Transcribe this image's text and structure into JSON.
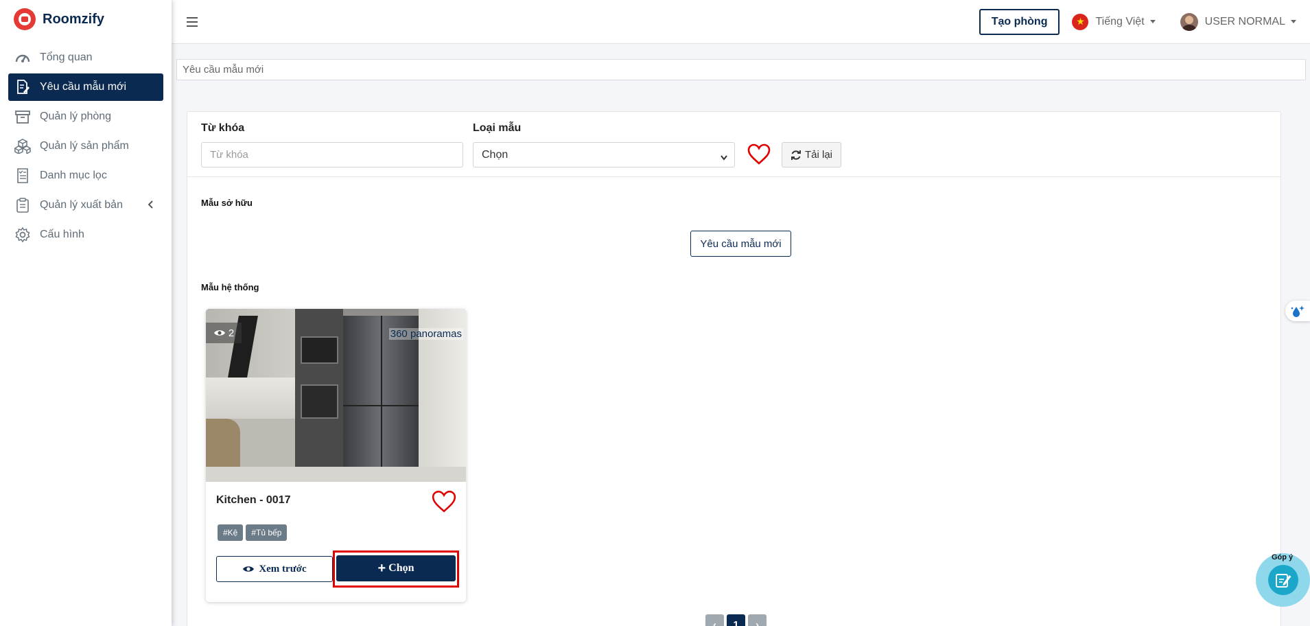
{
  "brand": {
    "name": "Roomzify"
  },
  "sidebar": {
    "items": [
      {
        "label": "Tổng quan"
      },
      {
        "label": "Yêu cầu mẫu mới"
      },
      {
        "label": "Quản lý phòng"
      },
      {
        "label": "Quản lý sản phẩm"
      },
      {
        "label": "Danh mục lọc"
      },
      {
        "label": "Quản lý xuất bản"
      },
      {
        "label": "Cấu hình"
      }
    ]
  },
  "header": {
    "create_label": "Tạo phòng",
    "language": "Tiếng Việt",
    "user": "USER NORMAL"
  },
  "breadcrumb": {
    "current": "Yêu cầu mẫu mới"
  },
  "filters": {
    "keyword_label": "Từ khóa",
    "keyword_placeholder": "Từ khóa",
    "type_label": "Loại mẫu",
    "type_selected": "Chọn",
    "reload_label": "Tải lại"
  },
  "owned": {
    "title": "Mẫu sở hữu",
    "request_label": "Yêu cầu mẫu mới"
  },
  "system": {
    "title": "Mẫu hệ thống",
    "templates": [
      {
        "views": "2",
        "panoramas": "360 panoramas",
        "name": "Kitchen - 0017",
        "tags": [
          "#Kệ",
          "#Tủ bếp"
        ],
        "preview_label": "Xem trước",
        "choose_label": "Chọn"
      }
    ]
  },
  "pagination": {
    "prev": "‹",
    "current": "1",
    "next": "›"
  },
  "feedback": {
    "label": "Góp ý"
  },
  "colors": {
    "primary": "#0b2a52",
    "heart": "#e00000",
    "highlight": "#e00000"
  }
}
